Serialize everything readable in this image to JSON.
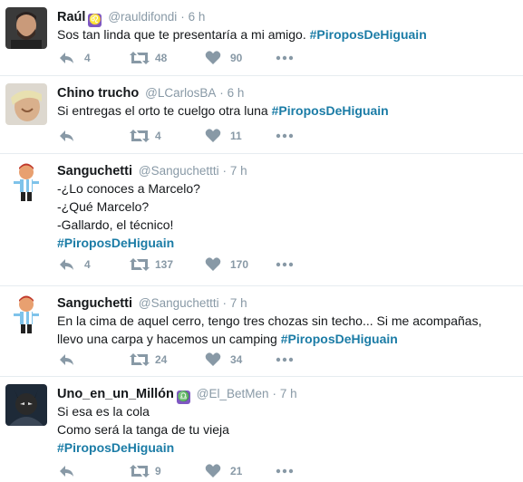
{
  "colors": {
    "hashtag": "#1b7ca6",
    "meta": "#8899a6",
    "divider": "#e6ecf0",
    "zodiac_badge": "#7e57c2"
  },
  "icons": {
    "reply": "reply-icon",
    "retweet": "retweet-icon",
    "like": "heart-icon",
    "more": "more-dots-icon"
  },
  "tweets": [
    {
      "name": "Raúl",
      "badge": "♌",
      "handle": "@rauldifondi",
      "time": "6 h",
      "text_lines": [
        "Sos tan linda que te presentaría a mi amigo."
      ],
      "hashtag": "#PiroposDeHiguain",
      "replies": "4",
      "retweets": "48",
      "likes": "90"
    },
    {
      "name": "Chino trucho",
      "handle": "@LCarlosBA",
      "time": "6 h",
      "text_lines": [
        "Si entregas el orto te cuelgo otra luna"
      ],
      "hashtag": "#PiroposDeHiguain",
      "replies": "",
      "retweets": "4",
      "likes": "11"
    },
    {
      "name": "Sanguchetti",
      "handle": "@Sanguchettti",
      "time": "7 h",
      "text_lines": [
        "-¿Lo conoces a Marcelo?",
        "-¿Qué Marcelo?",
        "-Gallardo, el técnico!"
      ],
      "hashtag": "#PiroposDeHiguain",
      "replies": "4",
      "retweets": "137",
      "likes": "170"
    },
    {
      "name": "Sanguchetti",
      "handle": "@Sanguchettti",
      "time": "7 h",
      "text_lines": [
        "En la cima de aquel cerro, tengo tres chozas sin techo... Si me acompañas,",
        "llevo una carpa y hacemos un camping"
      ],
      "hashtag": "#PiroposDeHiguain",
      "replies": "",
      "retweets": "24",
      "likes": "34"
    },
    {
      "name": "Uno_en_un_Millón",
      "badge": "♎",
      "handle": "@El_BetMen",
      "time": "7 h",
      "text_lines": [
        "Si esa es la cola",
        "Como será la tanga de tu vieja"
      ],
      "hashtag": "#PiroposDeHiguain",
      "replies": "",
      "retweets": "9",
      "likes": "21"
    }
  ]
}
